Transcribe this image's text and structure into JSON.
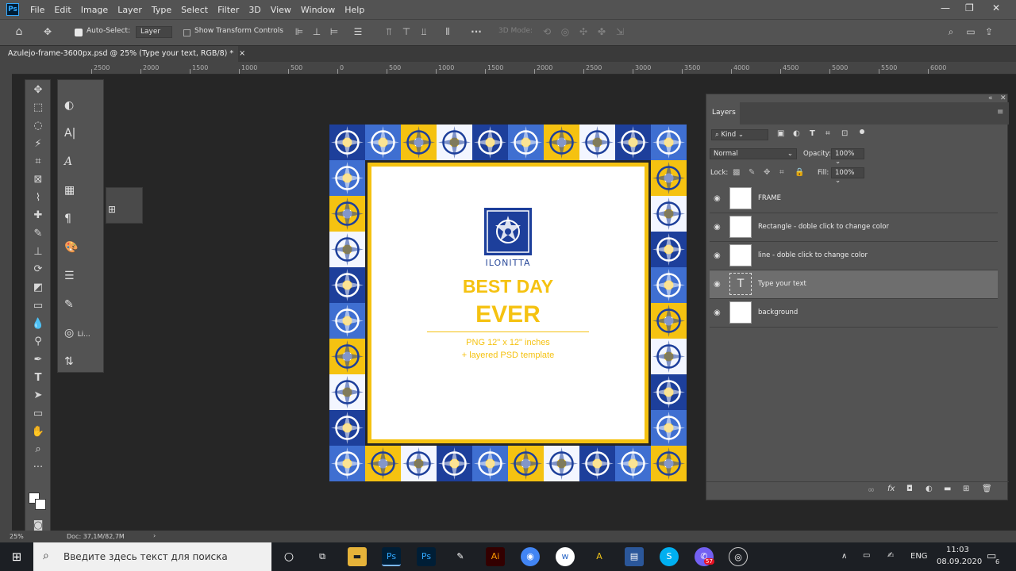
{
  "app": {
    "logo": "Ps"
  },
  "menu": [
    "File",
    "Edit",
    "Image",
    "Layer",
    "Type",
    "Select",
    "Filter",
    "3D",
    "View",
    "Window",
    "Help"
  ],
  "window_controls": {
    "minimize": "—",
    "restore": "❐",
    "close": "✕"
  },
  "options": {
    "auto_select_label": "Auto-Select:",
    "auto_select_value": "Layer",
    "show_transform_label": "Show Transform Controls",
    "mode_3d": "3D Mode:",
    "more": "···"
  },
  "document_tab": {
    "title": "Azulejo-frame-3600px.psd @ 25% (Type your text, RGB/8) *",
    "close": "×"
  },
  "ruler": {
    "ticks": [
      "2500",
      "2000",
      "1500",
      "1000",
      "500",
      "0",
      "500",
      "1000",
      "1500",
      "2000",
      "2500",
      "3000",
      "3500",
      "4000",
      "4500",
      "5000",
      "5500",
      "6000"
    ]
  },
  "canvas": {
    "brand": "ILONITTA",
    "title_line1": "BEST DAY",
    "title_line2": "EVER",
    "subtitle_line1": "PNG 12\" x 12\" inches",
    "subtitle_line2": "+ layered PSD template"
  },
  "side_panels": {
    "liquify_label": "Li..."
  },
  "layers_panel": {
    "title": "Layers",
    "kind_label": "Kind",
    "blend_mode": "Normal",
    "opacity_label": "Opacity:",
    "opacity_value": "100%",
    "lock_label": "Lock:",
    "fill_label": "Fill:",
    "fill_value": "100%",
    "layers": [
      {
        "name": "FRAME",
        "type": "pixel",
        "selected": false
      },
      {
        "name": "Rectangle - doble click to change color",
        "type": "shape",
        "selected": false
      },
      {
        "name": "line - doble click to change color",
        "type": "shape",
        "selected": false
      },
      {
        "name": "Type your text",
        "type": "text",
        "selected": true
      },
      {
        "name": "background",
        "type": "pixel",
        "selected": false
      }
    ],
    "footer_icons": [
      "link-icon",
      "fx-icon",
      "mask-icon",
      "adjustment-icon",
      "group-icon",
      "new-layer-icon",
      "trash-icon"
    ]
  },
  "status": {
    "zoom": "25%",
    "doc": "Doc: 37,1M/82,7M"
  },
  "taskbar": {
    "search_placeholder": "Введите здесь текст для поиска",
    "language": "ENG",
    "time": "11:03",
    "date": "08.09.2020",
    "notification_count": "6",
    "app_badge": "57"
  },
  "colors": {
    "ps_bg": "#535353",
    "canvas_bg": "#262626",
    "accent_yellow": "#f5c211",
    "tile_blue": "#1d3f9b",
    "selected_layer": "#6e6e6e"
  }
}
